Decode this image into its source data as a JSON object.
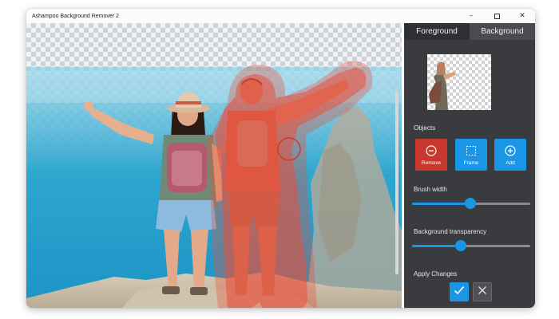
{
  "window": {
    "title": "Ashampoo Background Remover 2",
    "controls": {
      "minimize": "–",
      "close": "✕"
    }
  },
  "tabs": [
    {
      "label": "Foreground",
      "active": true
    },
    {
      "label": "Background",
      "active": false
    }
  ],
  "objects": {
    "label": "Objects",
    "buttons": [
      {
        "label": "Remove",
        "icon": "minus-circle-icon",
        "color": "#c8382e"
      },
      {
        "label": "Frame",
        "icon": "dashed-frame-icon",
        "color": "#1a96e6"
      },
      {
        "label": "Add",
        "icon": "plus-circle-icon",
        "color": "#1a96e6"
      }
    ]
  },
  "brush_width": {
    "label": "Brush width",
    "value_fraction": 0.49
  },
  "background_transparency": {
    "label": "Background transparency",
    "value_fraction": 0.41
  },
  "apply_changes": {
    "label": "Apply Changes",
    "confirm_icon": "checkmark-icon",
    "cancel_icon": "x-icon"
  },
  "colors": {
    "accent": "#1a96e6",
    "remove": "#c8382e",
    "panel_bg": "#3a3b3e",
    "selection_overlay": "#e8503c"
  }
}
